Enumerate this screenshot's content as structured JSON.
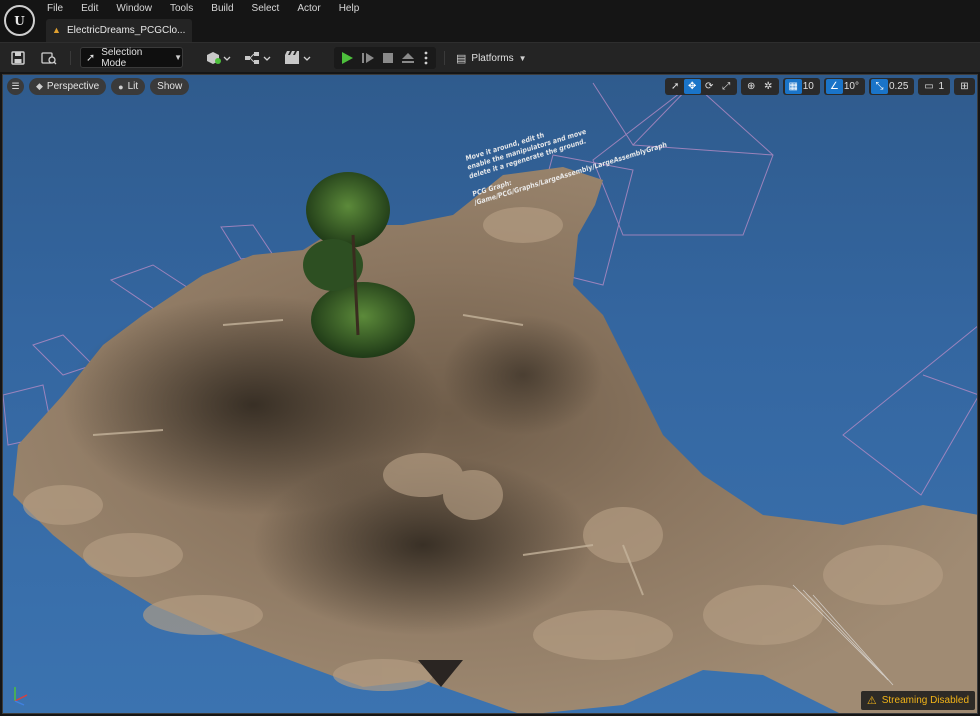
{
  "menu": {
    "items": [
      "File",
      "Edit",
      "Window",
      "Tools",
      "Build",
      "Select",
      "Actor",
      "Help"
    ]
  },
  "tab": {
    "title": "ElectricDreams_PCGClo..."
  },
  "toolbar": {
    "mode_label": "Selection Mode",
    "platforms_label": "Platforms"
  },
  "viewport": {
    "perspective_label": "Perspective",
    "lit_label": "Lit",
    "show_label": "Show",
    "grid_snap": "10",
    "rotation_snap": "10°",
    "scale_snap": "0.25",
    "camera_speed": "1",
    "streaming_label": "Streaming Disabled",
    "annotation": {
      "line1": "Move it around, edit th",
      "line2": "enable the manipulators and move",
      "line3": "delete it a regenerate the ground.",
      "line4": "PCG Graph:",
      "line5": "/Game/PCG/Graphs/LargeAssembly/LargeAssemblyGraph"
    }
  },
  "colors": {
    "sky": "#3466a0",
    "terrain": "#8a7560",
    "accent_blue": "#1a74c8",
    "play_green": "#4dbf3c",
    "warning": "#f2b418",
    "bounds_lines": "#b58bc4"
  },
  "icons": {
    "logo": "unreal-engine-logo",
    "save": "save-icon",
    "content_browser": "content-browser-icon",
    "add": "add-actor-icon",
    "blueprint": "blueprint-icon",
    "cinematics": "cinematics-icon",
    "play": "play-icon",
    "advance": "advance-frame-icon",
    "stop": "stop-icon",
    "eject": "eject-icon"
  }
}
